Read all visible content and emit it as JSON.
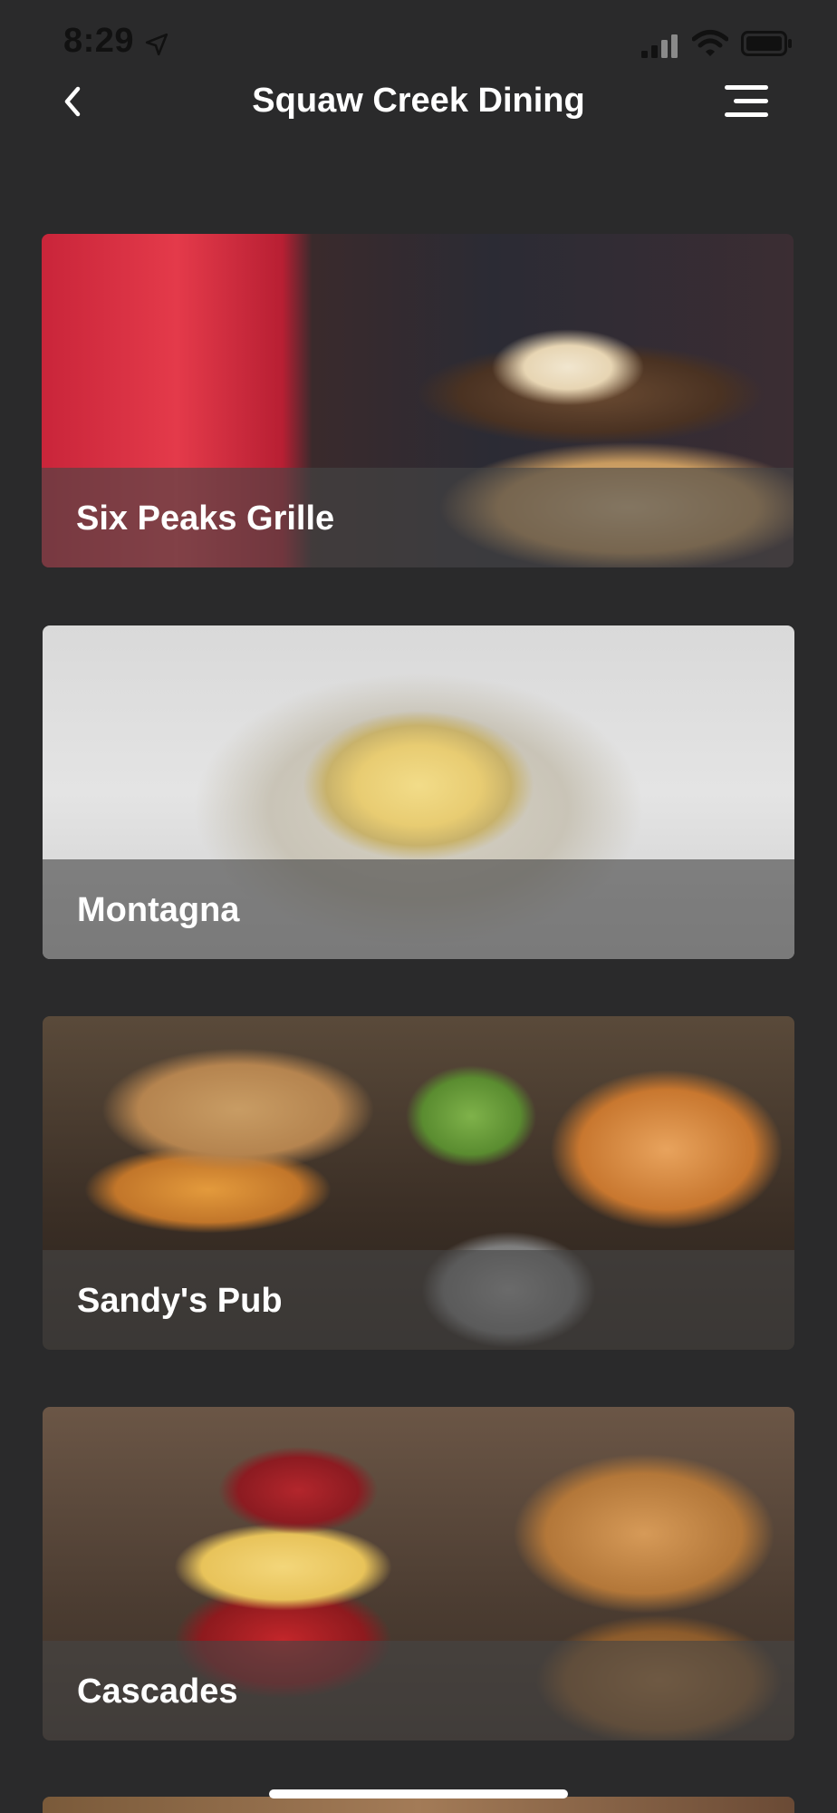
{
  "status_bar": {
    "time": "8:29"
  },
  "nav": {
    "title": "Squaw Creek Dining"
  },
  "restaurants": [
    {
      "name": "Six Peaks Grille"
    },
    {
      "name": "Montagna"
    },
    {
      "name": "Sandy's Pub"
    },
    {
      "name": "Cascades"
    }
  ],
  "colors": {
    "background": "#2a2a2b",
    "title_text": "#ffffff",
    "overlay": "rgba(70,70,70,0.62)"
  },
  "icons": {
    "back": "chevron-left-icon",
    "menu": "hamburger-menu-icon",
    "location": "location-arrow-icon",
    "signal": "cellular-signal-icon",
    "wifi": "wifi-icon",
    "battery": "battery-icon"
  }
}
